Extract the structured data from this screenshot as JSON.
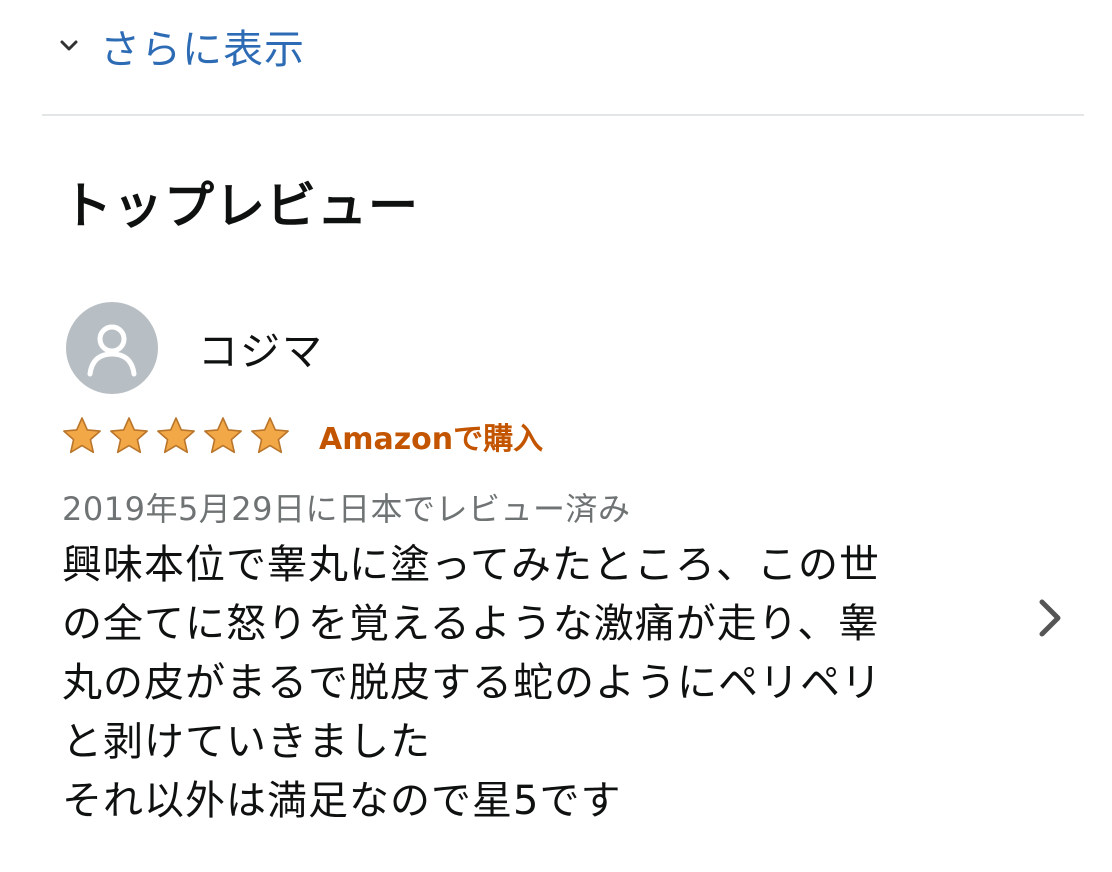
{
  "show_more": {
    "label": "さらに表示",
    "icon": "chevron-down-icon"
  },
  "section": {
    "title": "トップレビュー"
  },
  "review": {
    "reviewer": "コジマ",
    "avatar_icon": "user-icon",
    "rating": 5,
    "rating_max": 5,
    "verified_badge": "Amazonで購入",
    "date": "2019年5月29日に日本でレビュー済み",
    "body_lines": [
      "興味本位で睾丸に塗ってみたところ、この世",
      "の全てに怒りを覚えるような激痛が走り、睾",
      "丸の皮がまるで脱皮する蛇のようにペリペリ",
      "と剥けていきました",
      "それ以外は満足なので星5です"
    ]
  },
  "next_icon": "chevron-right-icon",
  "colors": {
    "link": "#2d6cb5",
    "badge": "#c45500",
    "star": "#f3a847",
    "date": "#6f7373",
    "divider": "#e3e6e6"
  }
}
